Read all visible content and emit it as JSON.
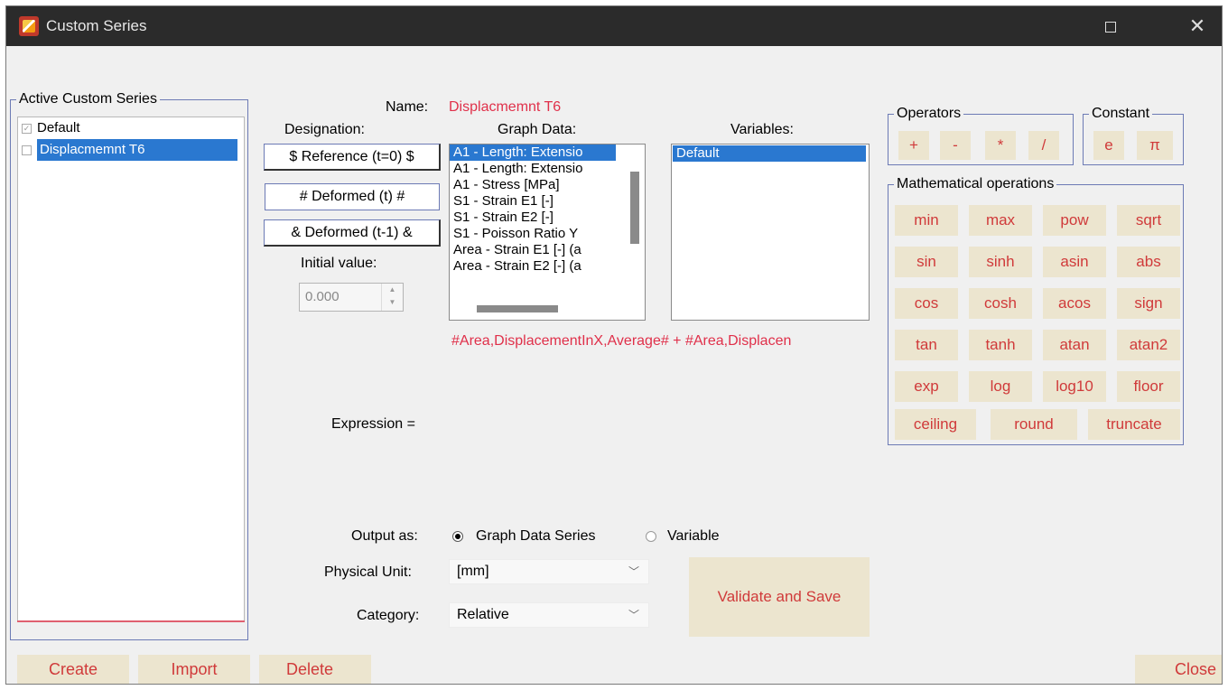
{
  "window": {
    "title": "Custom Series"
  },
  "active_series": {
    "legend": "Active Custom Series",
    "items": [
      {
        "label": "Default",
        "checked": true,
        "selected": false
      },
      {
        "label": "Displacmemnt T6",
        "checked": false,
        "selected": true
      }
    ]
  },
  "form": {
    "name_label": "Name:",
    "name_value": "Displacmemnt T6",
    "designation_label": "Designation:",
    "reference_button": "$ Reference (t=0) $",
    "deformed_button": "# Deformed  (t)   #",
    "deformed_prev_button": "& Deformed  (t-1) &",
    "initial_value_label": "Initial value:",
    "initial_value": "0.000",
    "graph_data_label": "Graph Data:",
    "graph_data_items": [
      "A1 - Length: Extensio",
      "A1 - Length: Extensio",
      "A1 - Stress [MPa]",
      "S1 - Strain E1 [-]",
      "S1 - Strain E2 [-]",
      "S1 - Poisson Ratio Y",
      "Area - Strain E1 [-] (a",
      "Area - Strain E2 [-] (a"
    ],
    "variables_label": "Variables:",
    "variables_items": [
      "Default"
    ],
    "expression_preview": "#Area,DisplacementInX,Average# + #Area,Displacen",
    "expression_label": "Expression =",
    "output_as_label": "Output as:",
    "output_option_series": "Graph Data Series",
    "output_option_variable": "Variable",
    "physical_unit_label": "Physical Unit:",
    "physical_unit_value": "[mm]",
    "category_label": "Category:",
    "category_value": "Relative",
    "validate_button": "Validate and Save"
  },
  "operators": {
    "legend": "Operators",
    "items": [
      "+",
      "-",
      "*",
      "/"
    ]
  },
  "constants": {
    "legend": "Constant",
    "items": [
      "e",
      "π"
    ]
  },
  "math_ops": {
    "legend": "Mathematical operations",
    "rows": [
      [
        "min",
        "max",
        "pow",
        "sqrt"
      ],
      [
        "sin",
        "sinh",
        "asin",
        "abs"
      ],
      [
        "cos",
        "cosh",
        "acos",
        "sign"
      ],
      [
        "tan",
        "tanh",
        "atan",
        "atan2"
      ],
      [
        "exp",
        "log",
        "log10",
        "floor"
      ],
      [
        "ceiling",
        "round",
        "truncate"
      ]
    ]
  },
  "footer": {
    "create": "Create",
    "import": "Import",
    "delete": "Delete",
    "close": "Close"
  },
  "colors": {
    "accent_red": "#e0304a",
    "selection_blue": "#2a78d0",
    "button_tan": "#ece5cf"
  }
}
